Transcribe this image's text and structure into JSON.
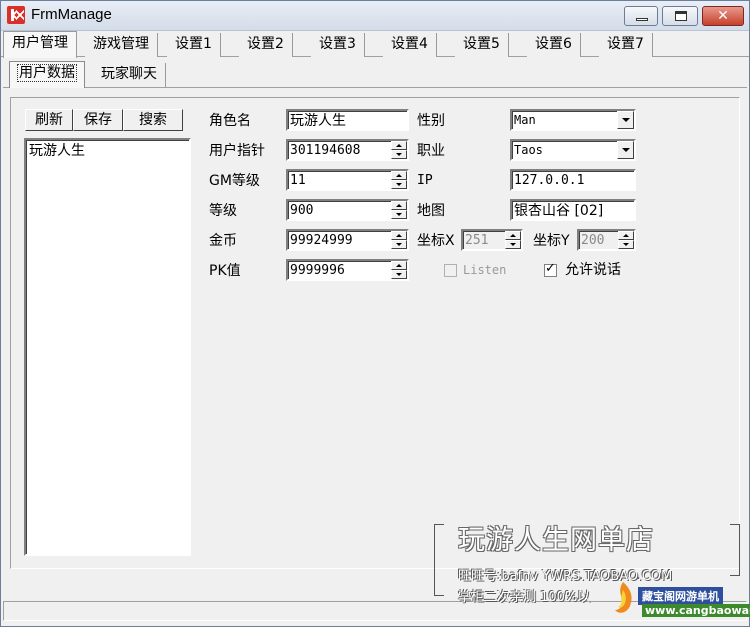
{
  "window": {
    "title": "FrmManage",
    "close_glyph": "✕"
  },
  "tabs": [
    "用户管理",
    "游戏管理",
    "设置1",
    "设置2",
    "设置3",
    "设置4",
    "设置5",
    "设置6",
    "设置7"
  ],
  "subtabs": [
    "用户数据",
    "玩家聊天"
  ],
  "list_panel": {
    "buttons": {
      "refresh": "刷新",
      "save": "保存",
      "search": "搜索"
    },
    "items": [
      "玩游人生"
    ]
  },
  "form": {
    "role_name": {
      "label": "角色名",
      "value": "玩游人生"
    },
    "user_pointer": {
      "label": "用户指针",
      "value": "301194608"
    },
    "gm_level": {
      "label": "GM等级",
      "value": "11"
    },
    "level": {
      "label": "等级",
      "value": "900"
    },
    "gold": {
      "label": "金币",
      "value": "99924999"
    },
    "pk_value": {
      "label": "PK值",
      "value": "9999996"
    },
    "gender": {
      "label": "性别",
      "value": "Man"
    },
    "job": {
      "label": "职业",
      "value": "Taos"
    },
    "ip": {
      "label": "IP",
      "value": "127.0.0.1"
    },
    "map": {
      "label": "地图",
      "value": "银杏山谷 [02]"
    },
    "coord_x": {
      "label": "坐标X",
      "value": "251"
    },
    "coord_y": {
      "label": "坐标Y",
      "value": "200"
    },
    "listen": {
      "label": "Listen",
      "checked": false,
      "enabled": false
    },
    "allow_talk": {
      "label": "允许说话",
      "checked": true
    }
  },
  "watermark": {
    "title": "玩游人生网单店",
    "line1": "旺旺号:bafnv  YWRS.TAOBAO.COM",
    "line2": "掌柜二次亲测 100%以",
    "site_name": "藏宝阁网游单机",
    "site_url": "www.cangbaowan.net"
  }
}
